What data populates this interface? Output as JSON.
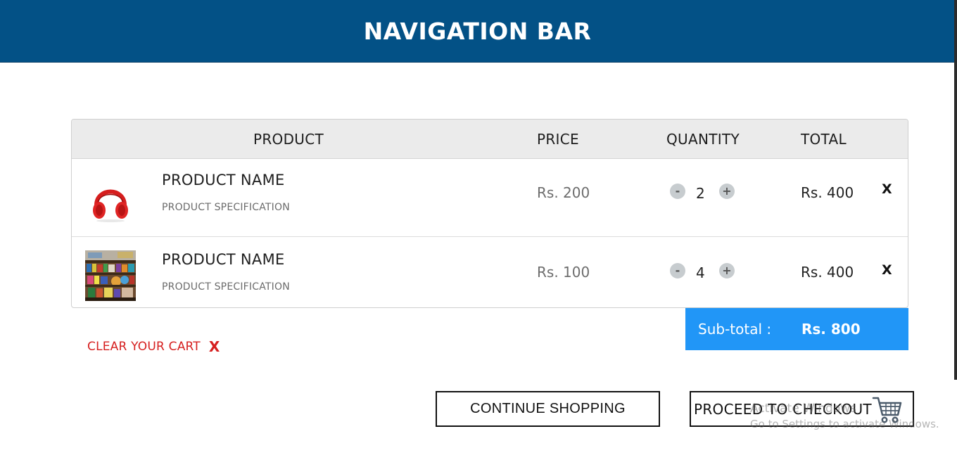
{
  "navbar": {
    "title": "NAVIGATION BAR"
  },
  "cart": {
    "headers": {
      "product": "PRODUCT",
      "price": "PRICE",
      "quantity": "QUANTITY",
      "total": "TOTAL"
    },
    "items": [
      {
        "image": "red-headphones",
        "name": "PRODUCT NAME",
        "spec": "PRODUCT SPECIFICATION",
        "price": "Rs. 200",
        "quantity": "2",
        "total": "Rs. 400",
        "minus": "-",
        "plus": "+",
        "remove": "X"
      },
      {
        "image": "store-shelves-photo",
        "name": "PRODUCT NAME",
        "spec": "PRODUCT SPECIFICATION",
        "price": "Rs. 100",
        "quantity": "4",
        "total": "Rs. 400",
        "minus": "-",
        "plus": "+",
        "remove": "X"
      }
    ],
    "subtotal": {
      "label": "Sub-total :",
      "value": "Rs. 800"
    },
    "clear": {
      "label": "CLEAR YOUR CART",
      "icon": "X"
    }
  },
  "actions": {
    "continue_label": "CONTINUE SHOPPING",
    "checkout_label": "PROCEED TO CHECKOUT",
    "checkout_icon": "shopping-cart-icon"
  },
  "watermark": {
    "line1": "Activate Windows",
    "line2": "Go to Settings to activate Windows."
  },
  "colors": {
    "navbar_bg": "#035186",
    "subtotal_bg": "#2196f7",
    "clear_red": "#d62020",
    "header_bg": "#ebebeb"
  }
}
